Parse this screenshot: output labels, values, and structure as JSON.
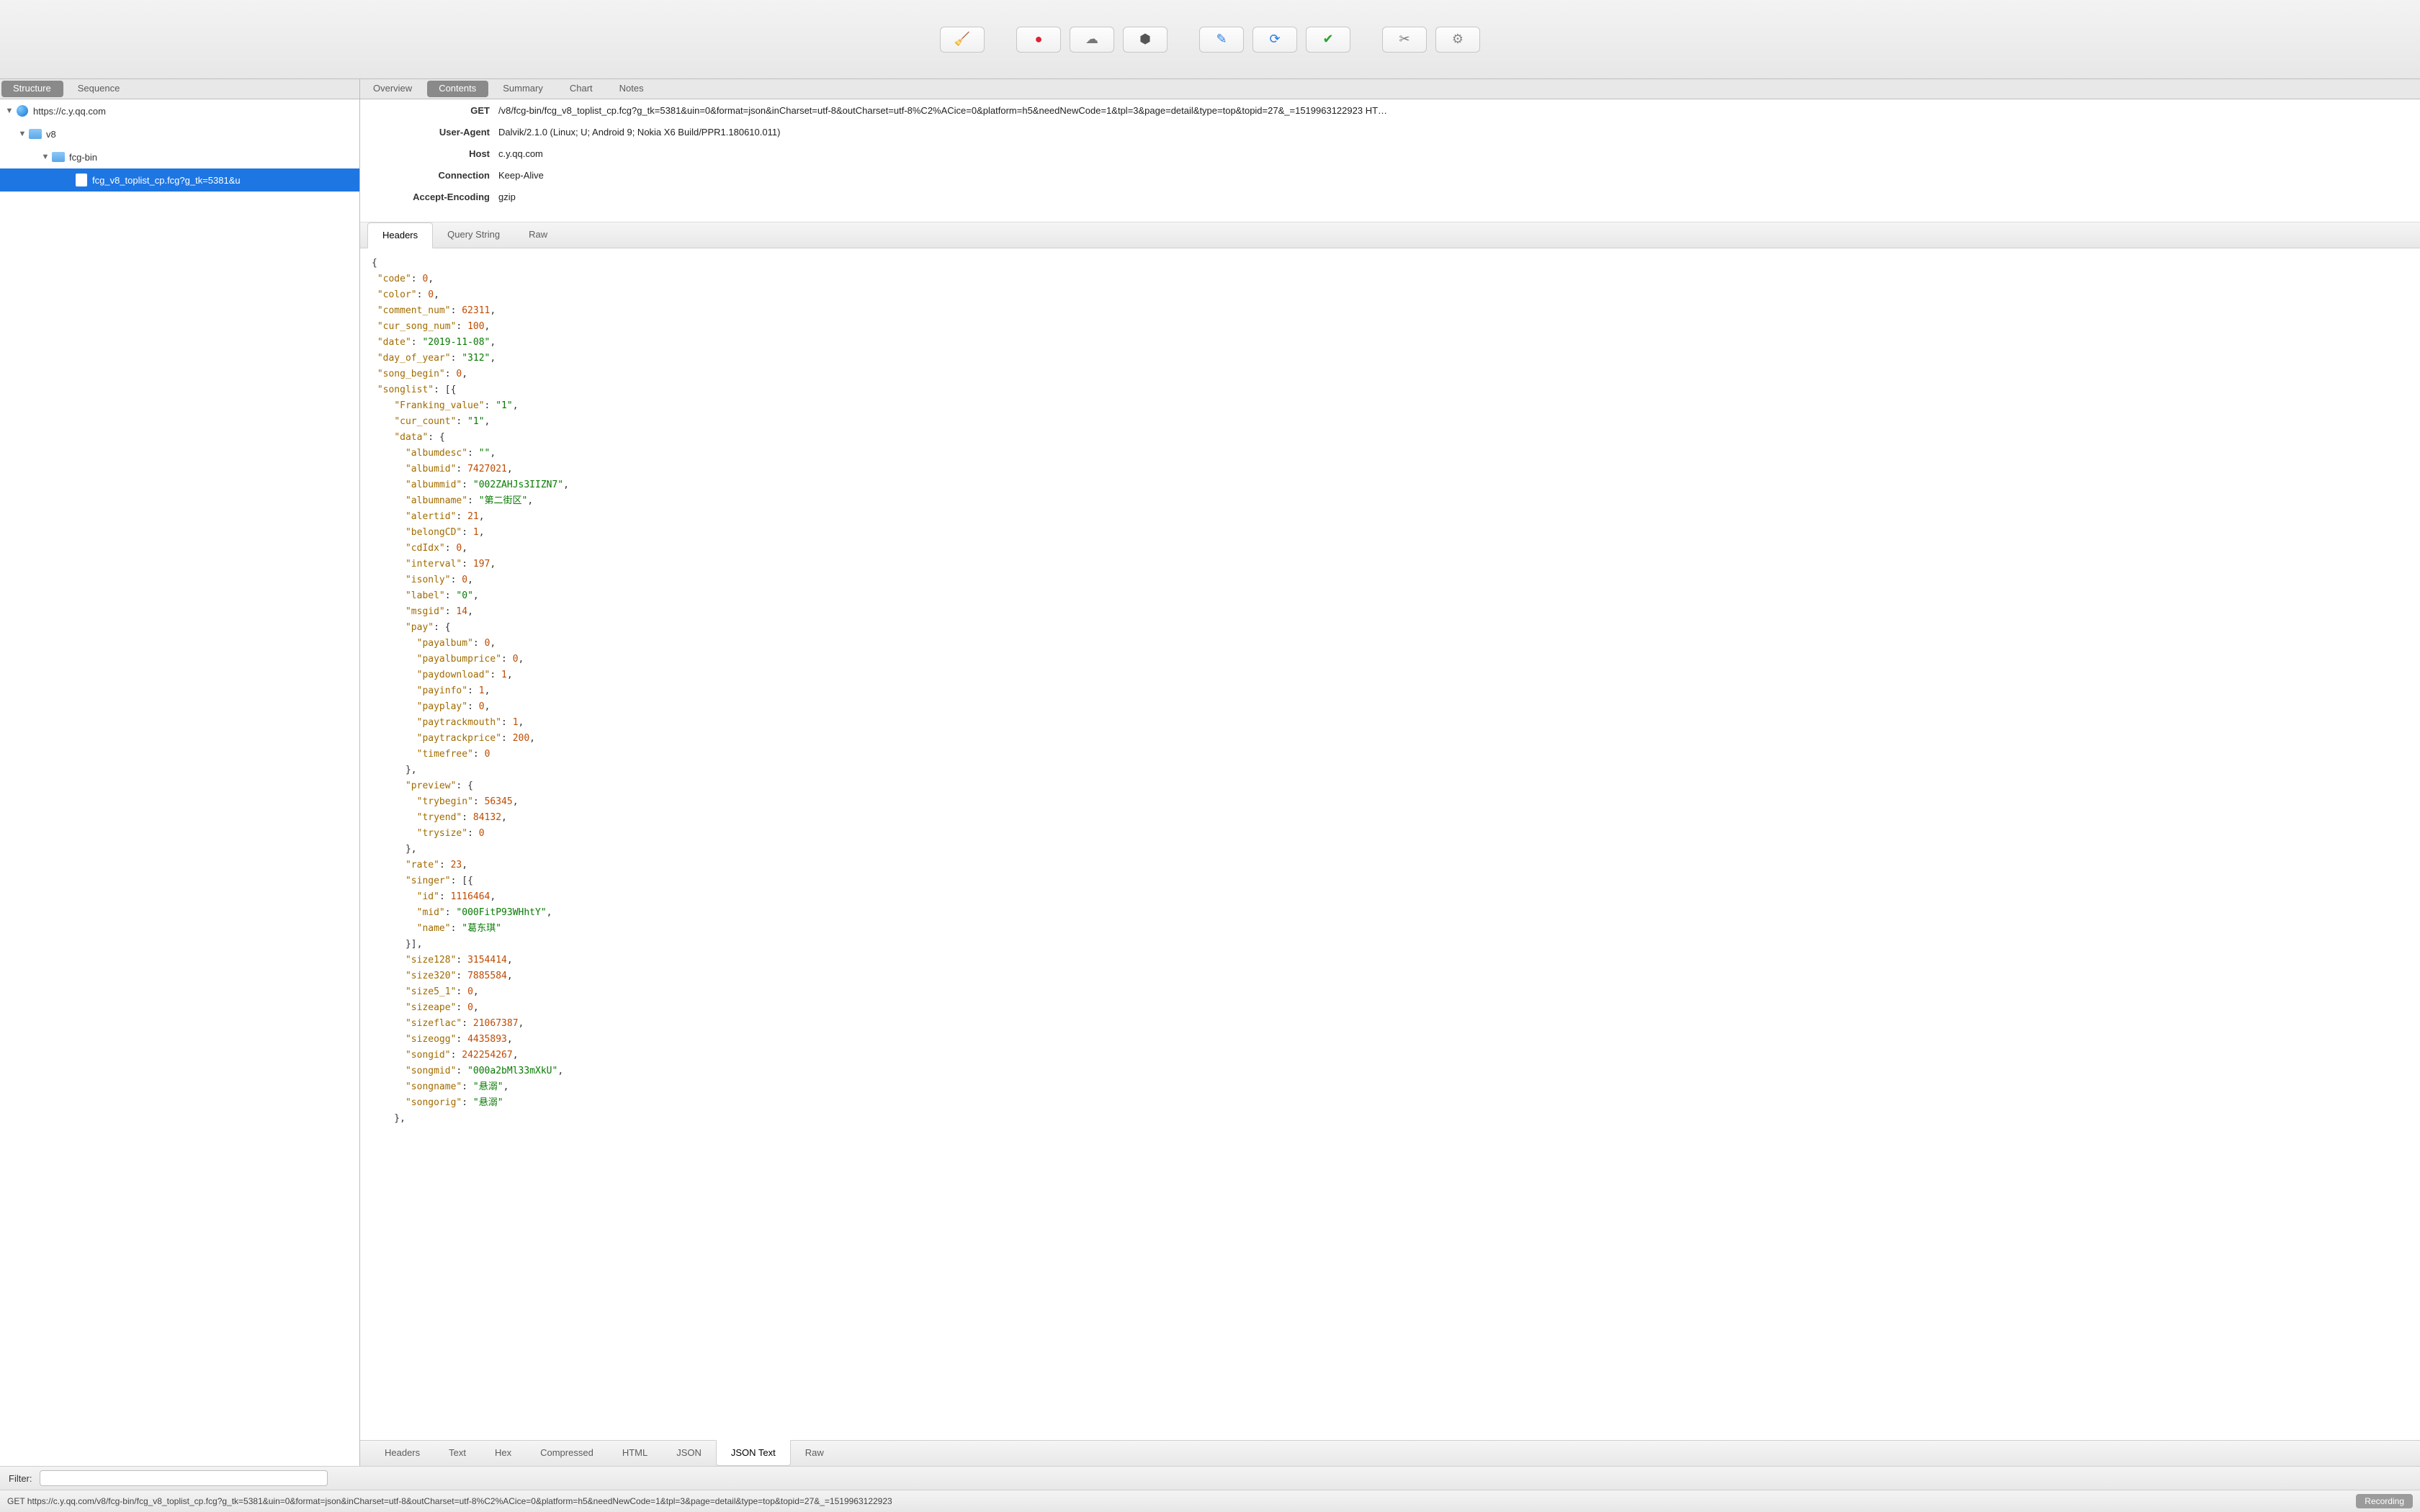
{
  "toolbar_icons": [
    "broom-icon",
    "record-icon",
    "cloud-icon",
    "hex-icon",
    "edit-icon",
    "refresh-icon",
    "check-icon",
    "tools-icon",
    "gear-icon"
  ],
  "left_view_tabs": [
    {
      "label": "Structure",
      "active": true
    },
    {
      "label": "Sequence",
      "active": false
    }
  ],
  "right_view_tabs": [
    {
      "label": "Overview",
      "active": false
    },
    {
      "label": "Contents",
      "active": true
    },
    {
      "label": "Summary",
      "active": false
    },
    {
      "label": "Chart",
      "active": false
    },
    {
      "label": "Notes",
      "active": false
    }
  ],
  "tree": {
    "host": "https://c.y.qq.com",
    "folder1": "v8",
    "folder2": "fcg-bin",
    "file": "fcg_v8_toplist_cp.fcg?g_tk=5381&u"
  },
  "request": {
    "method": "GET",
    "path": "/v8/fcg-bin/fcg_v8_toplist_cp.fcg?g_tk=5381&uin=0&format=json&inCharset=utf-8&outCharset=utf-8%C2%ACice=0&platform=h5&needNewCode=1&tpl=3&page=detail&type=top&topid=27&_=1519963122923",
    "proto": "HT…",
    "user_agent": "Dalvik/2.1.0 (Linux; U; Android 9; Nokia X6 Build/PPR1.180610.011)",
    "host": "c.y.qq.com",
    "connection": "Keep-Alive",
    "accept_encoding": "gzip"
  },
  "req_labels": {
    "method": "GET",
    "user_agent": "User-Agent",
    "host": "Host",
    "connection": "Connection",
    "accept_encoding": "Accept-Encoding"
  },
  "sub_nav": [
    {
      "label": "Headers",
      "active": true
    },
    {
      "label": "Query String",
      "active": false
    },
    {
      "label": "Raw",
      "active": false
    }
  ],
  "body_tabs": [
    {
      "label": "Headers",
      "active": false
    },
    {
      "label": "Text",
      "active": false
    },
    {
      "label": "Hex",
      "active": false
    },
    {
      "label": "Compressed",
      "active": false
    },
    {
      "label": "HTML",
      "active": false
    },
    {
      "label": "JSON",
      "active": false
    },
    {
      "label": "JSON Text",
      "active": true
    },
    {
      "label": "Raw",
      "active": false
    }
  ],
  "json_payload": {
    "code": 0,
    "color": 0,
    "comment_num": 62311,
    "cur_song_num": 100,
    "date": "2019-11-08",
    "day_of_year": "312",
    "song_begin": 0,
    "songlist": [
      {
        "Franking_value": "1",
        "cur_count": "1",
        "data": {
          "albumdesc": "",
          "albumid": 7427021,
          "albummid": "002ZAHJs3IIZN7",
          "albumname": "第二街区",
          "alertid": 21,
          "belongCD": 1,
          "cdIdx": 0,
          "interval": 197,
          "isonly": 0,
          "label": "0",
          "msgid": 14,
          "pay": {
            "payalbum": 0,
            "payalbumprice": 0,
            "paydownload": 1,
            "payinfo": 1,
            "payplay": 0,
            "paytrackmouth": 1,
            "paytrackprice": 200,
            "timefree": 0
          },
          "preview": {
            "trybegin": 56345,
            "tryend": 84132,
            "trysize": 0
          },
          "rate": 23,
          "singer": [
            {
              "id": 1116464,
              "mid": "000FitP93WHhtY",
              "name": "葛东琪"
            }
          ],
          "size128": 3154414,
          "size320": 7885584,
          "size5_1": 0,
          "sizeape": 0,
          "sizeflac": 21067387,
          "sizeogg": 4435893,
          "songid": 242254267,
          "songmid": "000a2bMl33mXkU",
          "songname": "悬溺",
          "songorig": "悬溺"
        }
      }
    ]
  },
  "filter": {
    "label": "Filter:",
    "value": ""
  },
  "status": {
    "text": "GET https://c.y.qq.com/v8/fcg-bin/fcg_v8_toplist_cp.fcg?g_tk=5381&uin=0&format=json&inCharset=utf-8&outCharset=utf-8%C2%ACice=0&platform=h5&needNewCode=1&tpl=3&page=detail&type=top&topid=27&_=1519963122923",
    "badge": "Recording"
  }
}
